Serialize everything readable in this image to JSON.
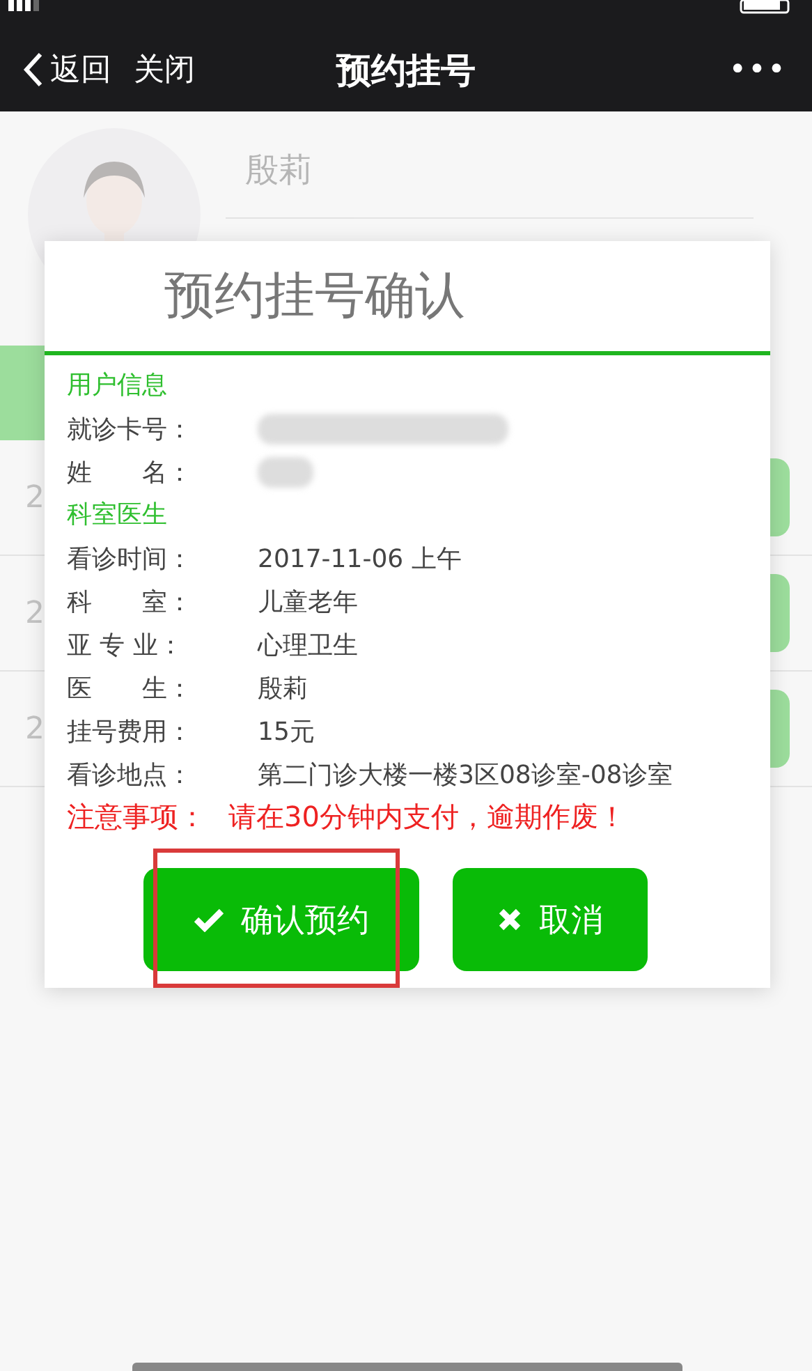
{
  "nav": {
    "back": "返回",
    "close": "关闭",
    "title": "预约挂号",
    "more": "•••"
  },
  "profile": {
    "name": "殷莉"
  },
  "list_rows": [
    {
      "number": "2"
    },
    {
      "number": "2"
    },
    {
      "number": "2"
    }
  ],
  "dialog": {
    "title": "预约挂号确认",
    "sections": [
      {
        "heading": "用户信息",
        "rows": [
          {
            "label": "就诊卡号：",
            "masked": true
          },
          {
            "label": "姓　　名：",
            "masked": true
          }
        ]
      },
      {
        "heading": "科室医生",
        "rows": [
          {
            "label": "看诊时间：",
            "value": "2017-11-06 上午",
            "masked": false
          },
          {
            "label": "科　　室：",
            "value": "儿童老年",
            "masked": false
          },
          {
            "label": "亚 专 业：",
            "value": "心理卫生",
            "masked": false
          },
          {
            "label": "医　　生：",
            "value": "殷莉",
            "masked": false
          },
          {
            "label": "挂号费用：",
            "value": "15元",
            "masked": false
          },
          {
            "label": "看诊地点：",
            "value": "第二门诊大楼一楼3区08诊室-08诊室",
            "masked": false
          }
        ]
      }
    ],
    "notice": {
      "label": "注意事项：",
      "text": "请在30分钟内支付，逾期作废！"
    },
    "buttons": [
      {
        "kind": "confirm",
        "label": "确认预约",
        "highlighted": true
      },
      {
        "kind": "cancel",
        "label": "取消",
        "highlighted": false
      }
    ]
  }
}
